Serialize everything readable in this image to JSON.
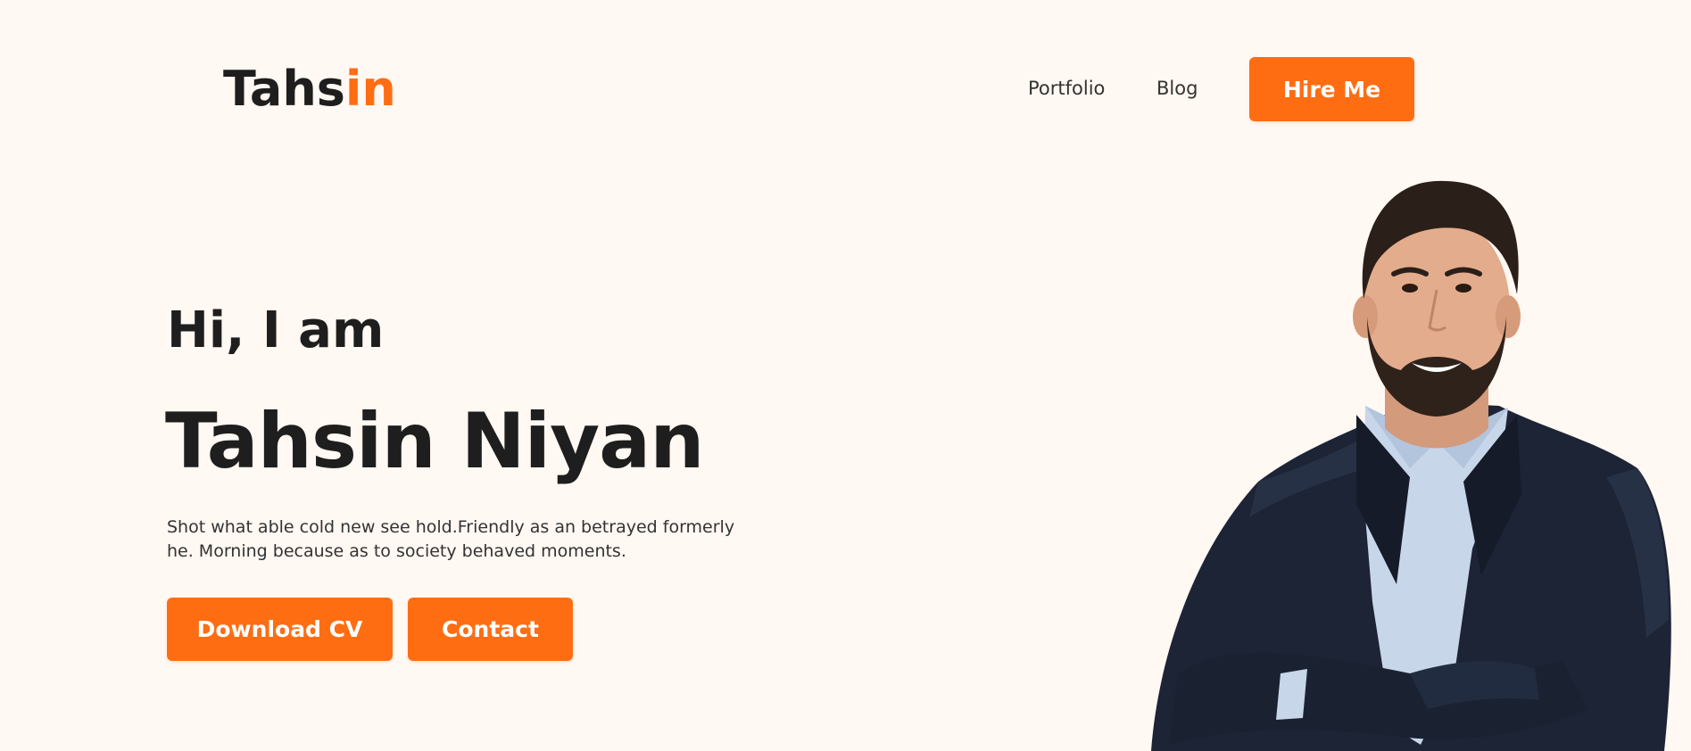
{
  "header": {
    "logo": {
      "part1": "Tahs",
      "part2": "in"
    },
    "nav": [
      {
        "label": "Portfolio"
      },
      {
        "label": "Blog"
      }
    ],
    "hire_label": "Hire Me"
  },
  "hero": {
    "greeting": "Hi, I am",
    "name": "Tahsin Niyan",
    "description": "Shot what able cold new see hold.Friendly as an betrayed formerly he. Morning because as to society behaved moments.",
    "buttons": {
      "download_label": "Download CV",
      "contact_label": "Contact"
    },
    "portrait": {
      "icon": "person-portrait"
    }
  },
  "colors": {
    "accent": "#ff6d12",
    "background": "#fff8f3",
    "text": "#1e1e1e"
  }
}
